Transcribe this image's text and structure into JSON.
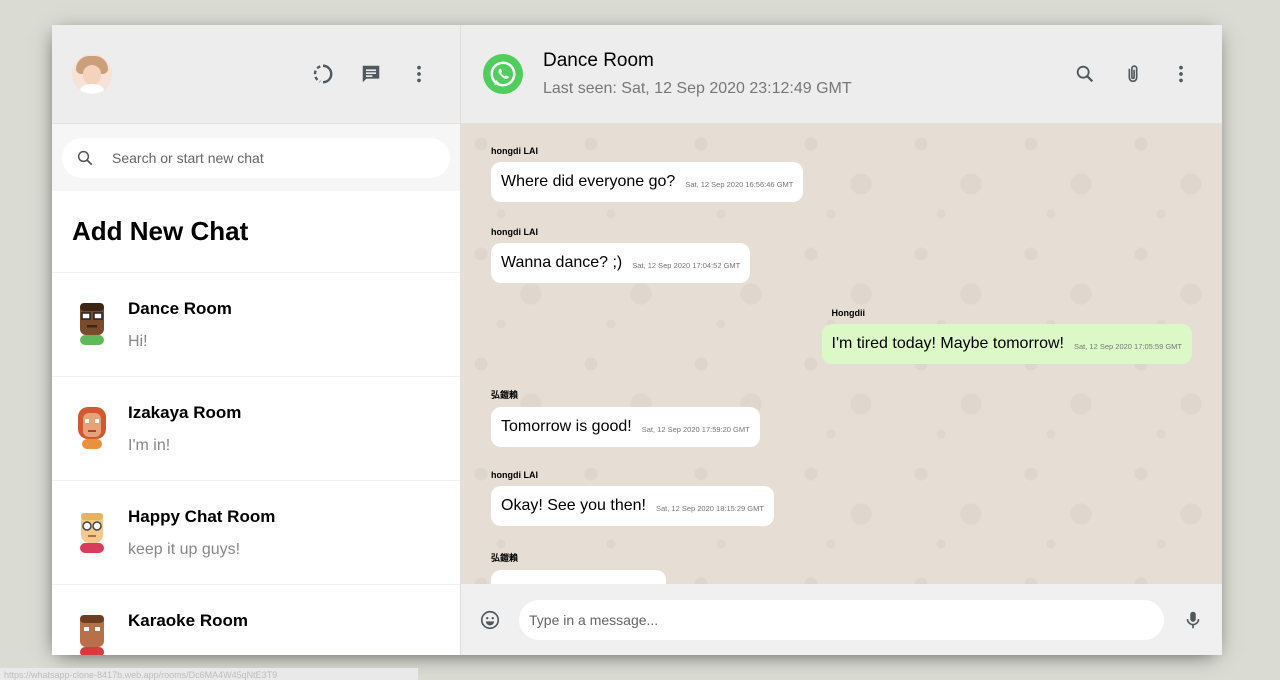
{
  "sidebar": {
    "search_placeholder": "Search or start new chat",
    "add_new_chat": "Add New Chat",
    "chats": [
      {
        "name": "Dance Room",
        "last": "Hi!",
        "avatar_color": "#7a4a2a"
      },
      {
        "name": "Izakaya Room",
        "last": "I'm in!",
        "avatar_color": "#d87a4a"
      },
      {
        "name": "Happy Chat Room",
        "last": "keep it up guys!",
        "avatar_color": "#f2c98a"
      },
      {
        "name": "Karaoke Room",
        "last": "",
        "avatar_color": "#b87048"
      }
    ]
  },
  "chat": {
    "room_name": "Dance Room",
    "last_seen": "Last seen: Sat, 12 Sep 2020 23:12:49 GMT",
    "messages": [
      {
        "sender": "hongdi LAI",
        "text": "Where did everyone go?",
        "time": "Sat, 12 Sep 2020 16:56:46 GMT",
        "mine": false
      },
      {
        "sender": "hongdi LAI",
        "text": "Wanna dance? ;)",
        "time": "Sat, 12 Sep 2020 17:04:52 GMT",
        "mine": false
      },
      {
        "sender": "Hongdii",
        "text": "I'm tired today! Maybe tomorrow!",
        "time": "Sat, 12 Sep 2020 17:05:59 GMT",
        "mine": true
      },
      {
        "sender": "弘鎧賴",
        "text": "Tomorrow is good!",
        "time": "Sat, 12 Sep 2020 17:59:20 GMT",
        "mine": false
      },
      {
        "sender": "hongdi LAI",
        "text": "Okay! See you then!",
        "time": "Sat, 12 Sep 2020 18:15:29 GMT",
        "mine": false
      },
      {
        "sender": "弘鎧賴",
        "text": "",
        "time": "",
        "mine": false
      }
    ],
    "input_placeholder": "Type in a message..."
  },
  "status_bar_url": "https://whatsapp-clone-8417b.web.app/rooms/Dc6MA4W45qNtE3T9",
  "colors": {
    "background": "#dadbd3",
    "header": "#ededed",
    "outgoing_bubble": "#dcf8c6",
    "chat_background": "#e6ded4",
    "logo_green": "#4fce5d"
  },
  "icons": {
    "header_left": [
      "status-icon",
      "new-chat-icon",
      "more-vert-icon"
    ],
    "header_right": [
      "search-icon",
      "attach-icon",
      "more-vert-icon"
    ],
    "footer": [
      "emoji-icon",
      "mic-icon"
    ]
  }
}
